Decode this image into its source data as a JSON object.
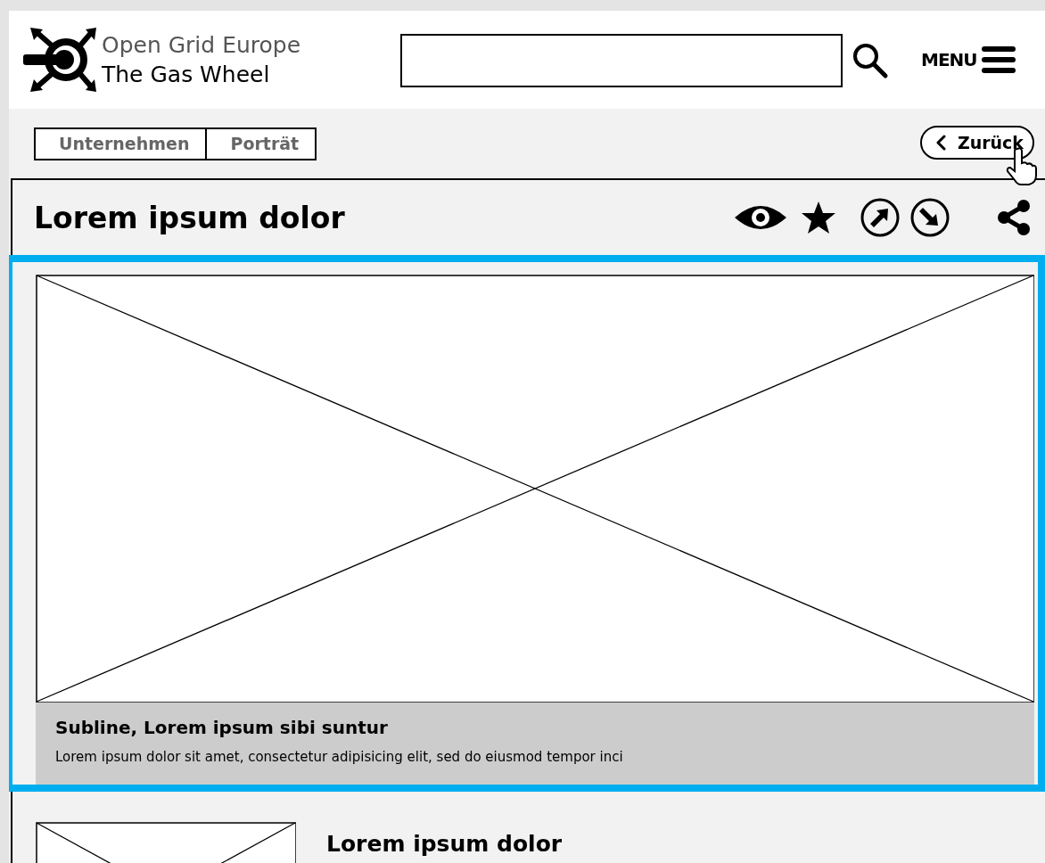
{
  "header": {
    "logo": {
      "line_1": "Open Grid Europe",
      "line_2": "The Gas Wheel"
    },
    "menu_label": "MENU"
  },
  "breadcrumb": [
    {
      "label": "Unternehmen"
    },
    {
      "label": "Porträt"
    }
  ],
  "back_button": {
    "label": "Zurück"
  },
  "article": {
    "title": "Lorem ipsum dolor",
    "teaser": {
      "selected": true,
      "subline": "Subline, Lorem ipsum sibi suntur",
      "text": "Lorem ipsum dolor sit amet, consectetur adipisicing elit, sed do eiusmod tempor inci"
    },
    "next_item": {
      "title": "Lorem ipsum dolor"
    }
  }
}
